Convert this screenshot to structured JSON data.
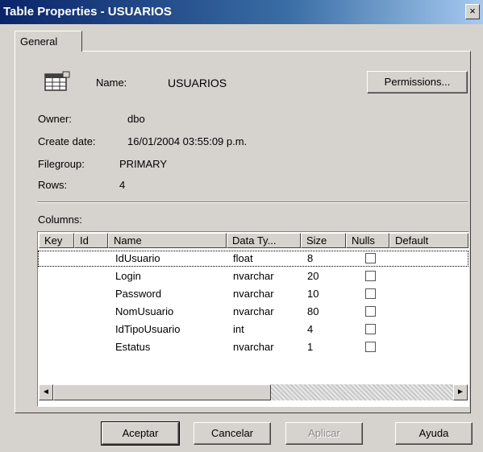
{
  "window": {
    "title": "Table Properties - USUARIOS",
    "close_glyph": "×"
  },
  "tabs": [
    {
      "label": "General"
    }
  ],
  "header": {
    "name_label": "Name:",
    "name_value": "USUARIOS",
    "permissions_label": "Permissions...",
    "icon": "table-icon"
  },
  "info": {
    "owner_label": "Owner:",
    "owner_value": "dbo",
    "create_date_label": "Create date:",
    "create_date_value": "16/01/2004 03:55:09 p.m.",
    "filegroup_label": "Filegroup:",
    "filegroup_value": "PRIMARY",
    "rows_label": "Rows:",
    "rows_value": "4"
  },
  "columns": {
    "label": "Columns:",
    "headers": [
      "Key",
      "Id",
      "Name",
      "Data Ty...",
      "Size",
      "Nulls",
      "Default"
    ],
    "rows": [
      {
        "name": "IdUsuario",
        "type": "float",
        "size": "8",
        "nulls": false
      },
      {
        "name": "Login",
        "type": "nvarchar",
        "size": "20",
        "nulls": false
      },
      {
        "name": "Password",
        "type": "nvarchar",
        "size": "10",
        "nulls": false
      },
      {
        "name": "NomUsuario",
        "type": "nvarchar",
        "size": "80",
        "nulls": false
      },
      {
        "name": "IdTipoUsuario",
        "type": "int",
        "size": "4",
        "nulls": false
      },
      {
        "name": "Estatus",
        "type": "nvarchar",
        "size": "1",
        "nulls": false
      }
    ],
    "scroll_left_glyph": "◄",
    "scroll_right_glyph": "►"
  },
  "buttons": {
    "ok": "Aceptar",
    "cancel": "Cancelar",
    "apply": "Aplicar",
    "help": "Ayuda"
  }
}
